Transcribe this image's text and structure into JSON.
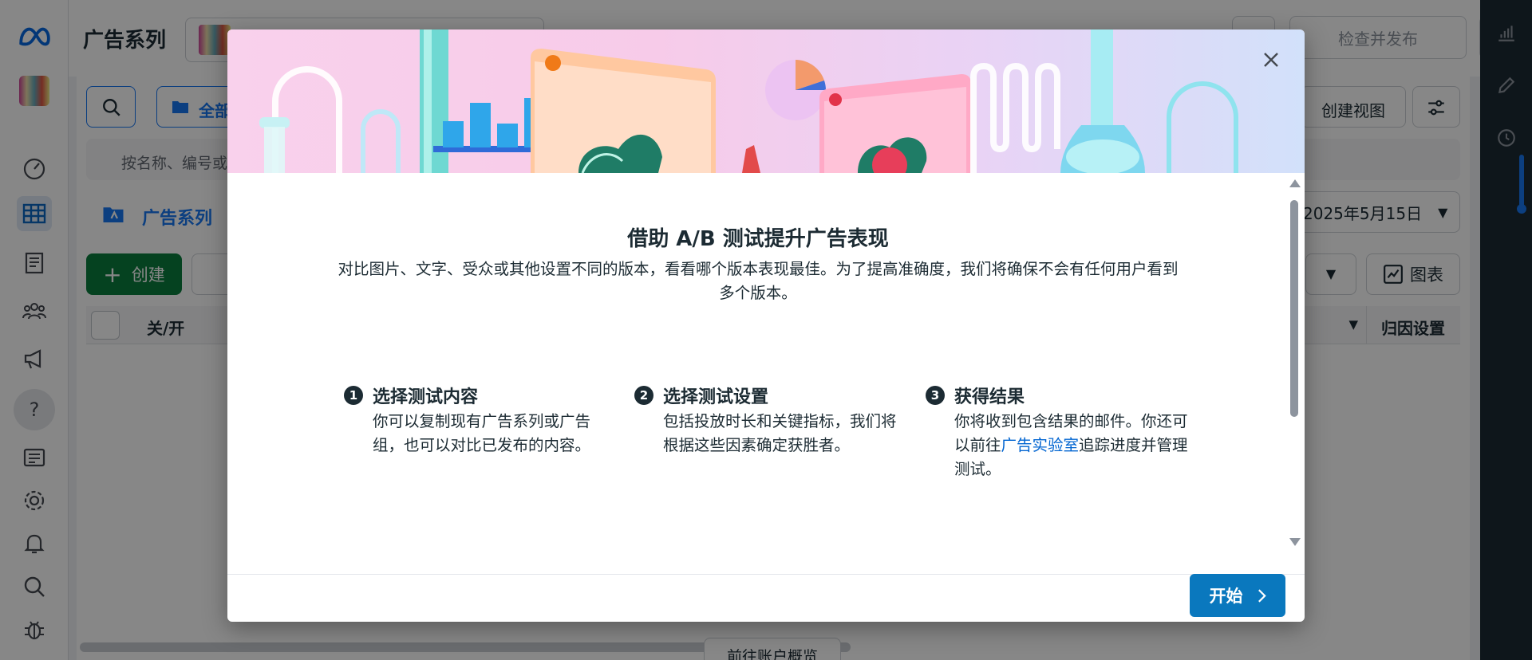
{
  "header": {
    "page_title": "广告系列",
    "review_publish": "检查并发布",
    "more": "···"
  },
  "toolbar": {
    "folder_label": "全部",
    "create_view": "创建视图",
    "filter_placeholder": "按名称、编号或",
    "date_range": "2025年5月15日",
    "tab_campaign": "广告系列",
    "create_button": "创建",
    "chart_button": "图表"
  },
  "table": {
    "col_onoff": "关/开",
    "col_attribution": "归因设置"
  },
  "bottom": {
    "account_overview": "前往账户概览"
  },
  "nav": {
    "help": "?"
  },
  "modal": {
    "title": "借助 A/B 测试提升广告表现",
    "description": "对比图片、文字、受众或其他设置不同的版本，看看哪个版本表现最佳。为了提高准确度，我们将确保不会有任何用户看到多个版本。",
    "steps": [
      {
        "num": "1",
        "title": "选择测试内容",
        "text": "你可以复制现有广告系列或广告组，也可以对比已发布的内容。"
      },
      {
        "num": "2",
        "title": "选择测试设置",
        "text": "包括投放时长和关键指标，我们将根据这些因素确定获胜者。"
      },
      {
        "num": "3",
        "title": "获得结果",
        "text_before": "你将收到包含结果的邮件。你还可以前往",
        "link": "广告实验室",
        "text_after": "追踪进度并管理测试。"
      }
    ],
    "start_button": "开始"
  },
  "colors": {
    "primary_blue": "#0a78be",
    "create_green": "#0a7d3e",
    "rail_dark": "#1c2b33"
  }
}
